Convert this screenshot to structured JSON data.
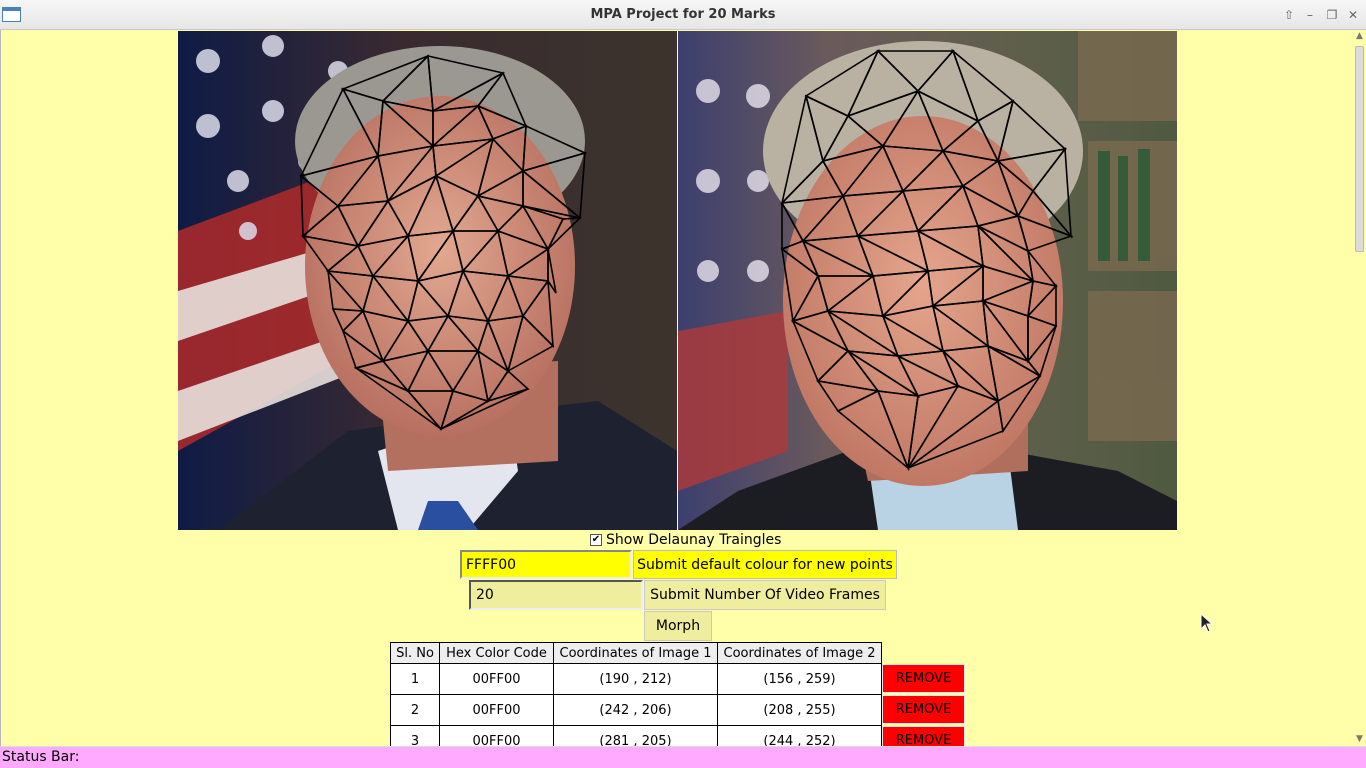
{
  "window": {
    "title": "MPA Project for 20 Marks"
  },
  "images": {
    "image1_description_icon": "portrait-photo",
    "image2_description_icon": "portrait-photo"
  },
  "controls": {
    "show_triangles_label": "Show Delaunay Traingles",
    "show_triangles_checked": true,
    "colour_value": "FFFF00",
    "colour_button_label": "Submit default colour for new points",
    "frames_value": "20",
    "frames_button_label": "Submit Number Of Video Frames",
    "morph_button_label": "Morph"
  },
  "table": {
    "headers": [
      "Sl. No",
      "Hex Color Code",
      "Coordinates of Image 1",
      "Coordinates of Image 2"
    ],
    "rows": [
      {
        "sl": "1",
        "hex": "00FF00",
        "coord1": "(190 , 212)",
        "coord2": "(156 , 259)",
        "action": "REMOVE"
      },
      {
        "sl": "2",
        "hex": "00FF00",
        "coord1": "(242 , 206)",
        "coord2": "(208 , 255)",
        "action": "REMOVE"
      },
      {
        "sl": "3",
        "hex": "00FF00",
        "coord1": "(281 , 205)",
        "coord2": "(244 , 252)",
        "action": "REMOVE"
      }
    ]
  },
  "status": {
    "text": "Status Bar:"
  },
  "colors": {
    "background": "#ffffaa",
    "status_bar": "#ffaaff",
    "remove_button": "#ff0000",
    "colour_field": "#ffff00",
    "mesh_lines": "#000000"
  }
}
